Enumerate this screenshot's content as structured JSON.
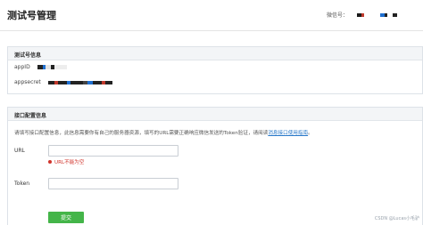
{
  "header": {
    "title": "测试号管理",
    "wechat_id_label": "微信号："
  },
  "test_account": {
    "title": "测试号信息",
    "appid_label": "appID",
    "appsecret_label": "appsecret"
  },
  "interface_config": {
    "title": "接口配置信息",
    "intro_text": "请填写接口配置信息，此信息需要你有自己的服务器资源，填写的URL需要正确响应微信发送的Token验证，请阅读",
    "intro_link": "消息接口使用指南",
    "intro_end": "。",
    "url_label": "URL",
    "url_value": "",
    "url_error": "URL不能为空",
    "token_label": "Token",
    "token_value": "",
    "submit_label": "提交"
  },
  "watermark": "CSDN @Lucas小毛驴",
  "colors": {
    "accent_green": "#44b549",
    "link_blue": "#2a79c9",
    "error_red": "#d0342c"
  }
}
